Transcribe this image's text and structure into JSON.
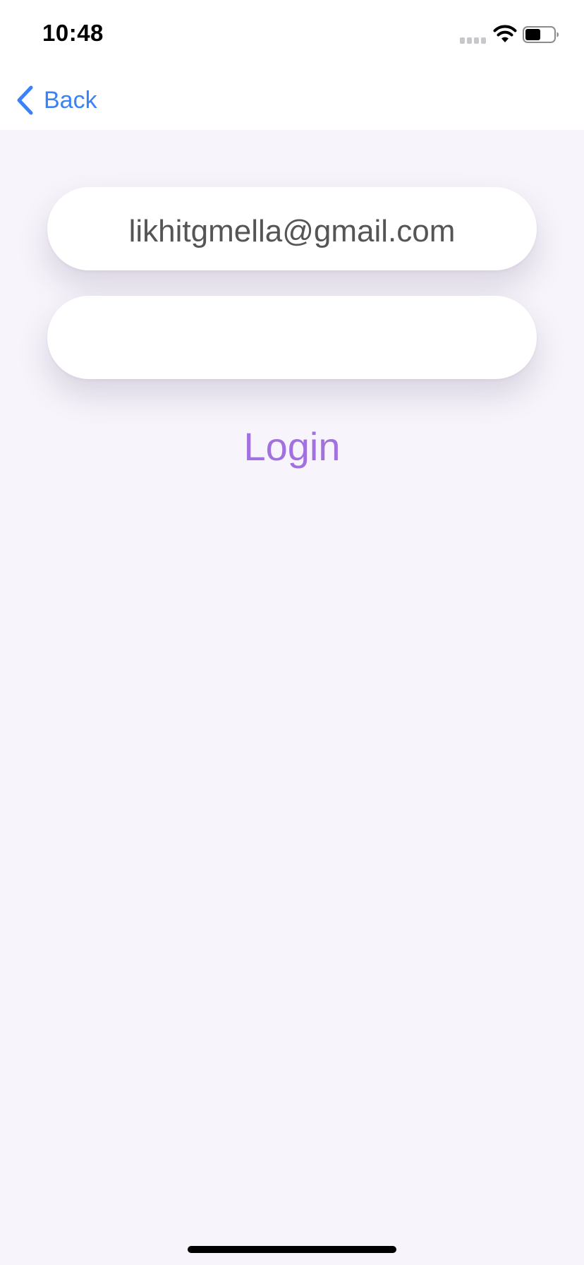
{
  "status_bar": {
    "time": "10:48",
    "icons": [
      "cellular-signal-icon",
      "wifi-icon",
      "battery-icon"
    ],
    "battery_level": 0.5
  },
  "nav": {
    "back_label": "Back",
    "back_icon": "chevron-left-icon"
  },
  "form": {
    "email_value": "likhitgmella@gmail.com",
    "password_value": ""
  },
  "login_label": "Login",
  "colors": {
    "accent_blue": "#3a82f7",
    "login_purple": "#a171df",
    "background": "#f7f4fb"
  }
}
